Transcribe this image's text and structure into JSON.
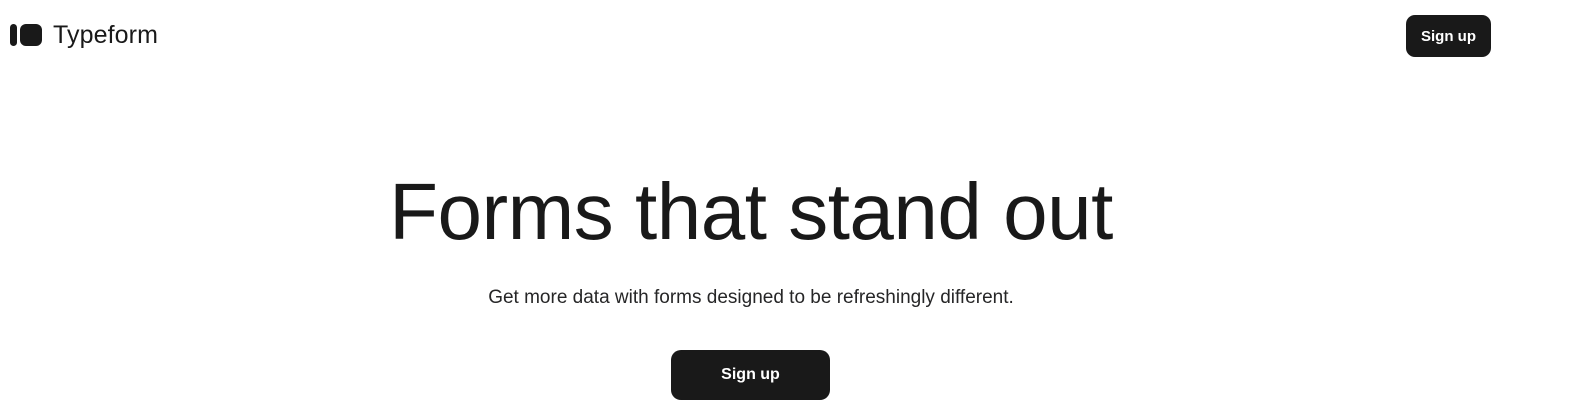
{
  "header": {
    "logo_icon": "typeform-logo-icon",
    "brand_name": "Typeform",
    "signup_label": "Sign up"
  },
  "hero": {
    "title": "Forms that stand out",
    "subtitle": "Get more data with forms designed to be refreshingly different.",
    "signup_label": "Sign up"
  },
  "colors": {
    "background": "#ffffff",
    "text": "#191919",
    "button_bg": "#191919",
    "button_text": "#ffffff"
  }
}
